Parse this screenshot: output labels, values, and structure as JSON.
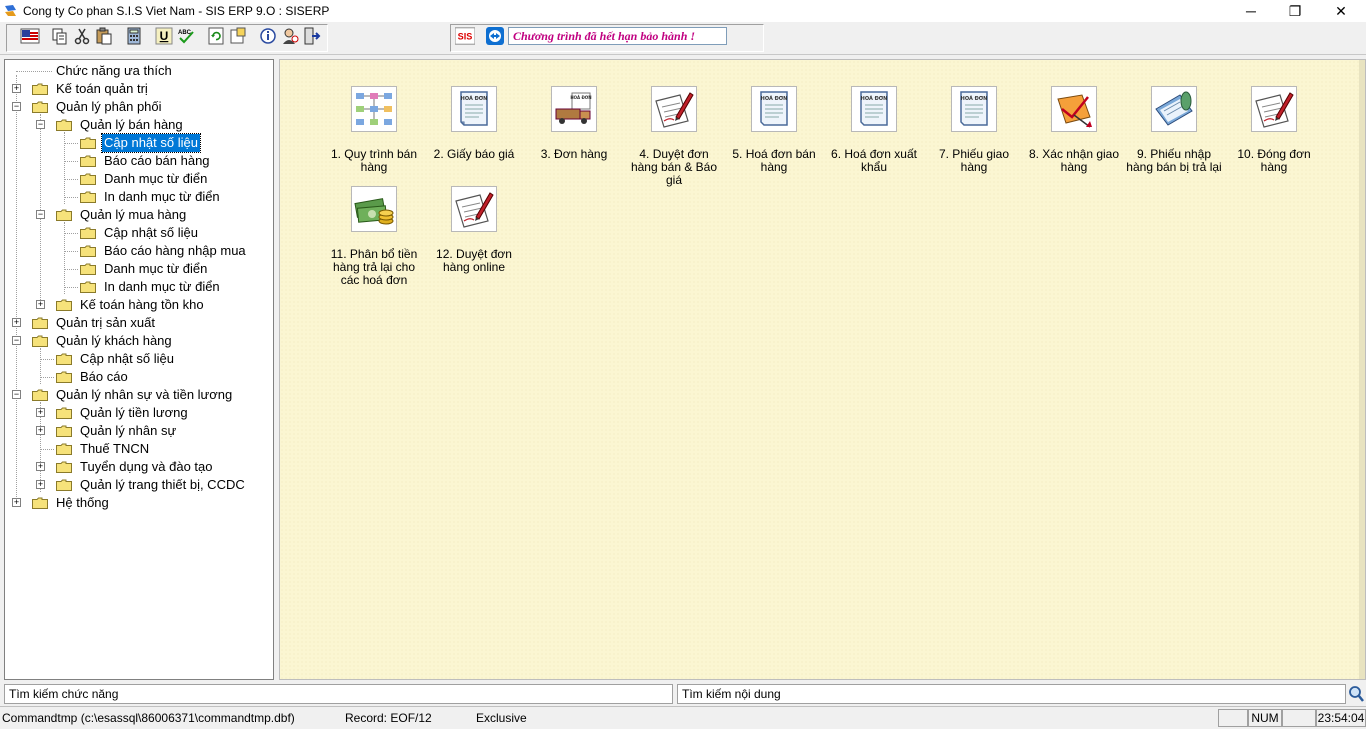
{
  "window": {
    "title": "Cong ty Co phan S.I.S Viet Nam - SIS ERP 9.O : SISERP",
    "minimize": "─",
    "maximize": "❐",
    "close": "✕"
  },
  "toolbar": {
    "warning_text": "Chương trình đã hết hạn bảo hành !",
    "sis_logo_text": "SIS"
  },
  "tree": {
    "items": [
      {
        "label": "Chức năng ưa thích"
      },
      {
        "label": "Kế toán quản trị"
      },
      {
        "label": "Quản lý phân phối"
      },
      {
        "label": "Quản lý bán hàng"
      },
      {
        "label": "Cập nhật số liệu"
      },
      {
        "label": "Báo cáo bán hàng"
      },
      {
        "label": "Danh mục từ điển"
      },
      {
        "label": "In danh mục từ điển"
      },
      {
        "label": "Quản lý mua hàng"
      },
      {
        "label": "Cập nhật số liệu"
      },
      {
        "label": "Báo cáo hàng nhập mua"
      },
      {
        "label": "Danh mục từ điển"
      },
      {
        "label": "In danh mục từ điển"
      },
      {
        "label": "Kế toán hàng tồn kho"
      },
      {
        "label": "Quản trị sản xuất"
      },
      {
        "label": "Quản lý khách hàng"
      },
      {
        "label": "Cập nhật số liệu"
      },
      {
        "label": "Báo cáo"
      },
      {
        "label": "Quản lý nhân sự và tiền lương"
      },
      {
        "label": "Quản lý tiền lương"
      },
      {
        "label": "Quản lý nhân sự"
      },
      {
        "label": "Thuế TNCN"
      },
      {
        "label": "Tuyển dụng và đào tạo"
      },
      {
        "label": "Quản lý trang thiết bị, CCDC"
      },
      {
        "label": "Hệ thống"
      }
    ]
  },
  "functions": [
    {
      "label": "1. Quy trình bán hàng"
    },
    {
      "label": "2. Giấy báo giá",
      "badge": "HOÁ ĐƠN"
    },
    {
      "label": "3. Đơn hàng",
      "badge": "HOÁ ĐƠN"
    },
    {
      "label": "4. Duyệt đơn hàng bán & Báo giá"
    },
    {
      "label": "5. Hoá đơn bán hàng",
      "badge": "HOÁ ĐƠN"
    },
    {
      "label": "6. Hoá đơn xuất khẩu",
      "badge": "HOÁ ĐƠN"
    },
    {
      "label": "7. Phiếu giao hàng",
      "badge": "HOÁ ĐƠN"
    },
    {
      "label": "8. Xác nhận giao hàng"
    },
    {
      "label": "9. Phiếu nhập hàng bán bị trả lại"
    },
    {
      "label": "10. Đóng đơn hàng"
    },
    {
      "label": "11. Phân bổ tiền hàng trả lại cho các hoá đơn"
    },
    {
      "label": "12. Duyệt đơn hàng online"
    }
  ],
  "search": {
    "function_placeholder": "Tìm kiếm chức năng",
    "content_placeholder": "Tìm kiếm nội dung"
  },
  "status": {
    "file": "Commandtmp (c:\\esassql\\86006371\\commandtmp.dbf)",
    "record": "Record: EOF/12",
    "mode": "Exclusive",
    "num": "NUM",
    "time": "23:54:04"
  }
}
